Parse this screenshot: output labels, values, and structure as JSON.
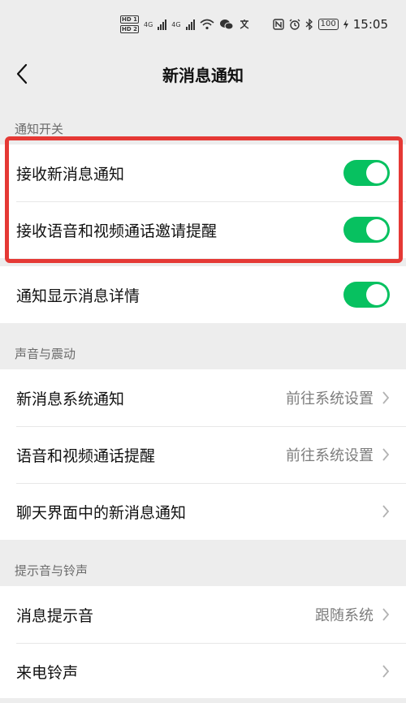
{
  "status_bar": {
    "hd1": "HD 1",
    "hd2": "HD 2",
    "net1": "4G",
    "net2": "4G",
    "battery": "100",
    "time": "15:05"
  },
  "nav": {
    "title": "新消息通知"
  },
  "sections": {
    "notify_switch": {
      "header": "通知开关",
      "items": [
        {
          "label": "接收新消息通知",
          "toggle_on": true
        },
        {
          "label": "接收语音和视频通话邀请提醒",
          "toggle_on": true
        },
        {
          "label": "通知显示消息详情",
          "toggle_on": true
        }
      ]
    },
    "sound_vibration": {
      "header": "声音与震动",
      "items": [
        {
          "label": "新消息系统通知",
          "value": "前往系统设置"
        },
        {
          "label": "语音和视频通话提醒",
          "value": "前往系统设置"
        },
        {
          "label": "聊天界面中的新消息通知",
          "value": ""
        }
      ]
    },
    "tones": {
      "header": "提示音与铃声",
      "items": [
        {
          "label": "消息提示音",
          "value": "跟随系统"
        },
        {
          "label": "来电铃声",
          "value": ""
        }
      ]
    }
  },
  "colors": {
    "toggle_on": "#07c160",
    "highlight": "#e53935",
    "background": "#ededed"
  }
}
